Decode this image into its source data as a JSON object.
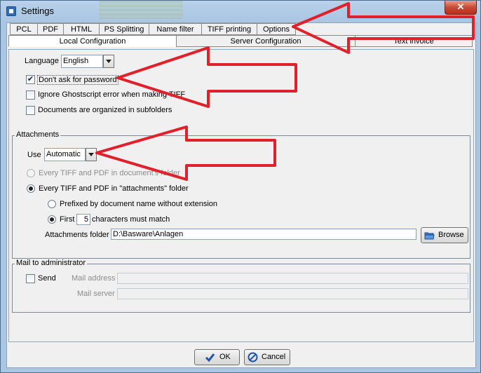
{
  "window": {
    "title": "Settings",
    "close_glyph": "✕"
  },
  "tabs_row1": [
    "PCL",
    "PDF",
    "HTML",
    "PS Splitting",
    "Name filter",
    "TIFF printing",
    "Options"
  ],
  "tabs_row2": [
    "Local Configuration",
    "Server Configuration",
    "Text invoice"
  ],
  "general": {
    "language_label": "Language",
    "language_value": "English",
    "dont_ask_password": "Don't ask for password",
    "dont_ask_password_checked": true,
    "ignore_ghostscript": "Ignore Ghostscript error when making TIFF",
    "ignore_ghostscript_checked": false,
    "subfolders": "Documents are organized in subfolders",
    "subfolders_checked": false
  },
  "attachments": {
    "legend": "Attachments",
    "use_label": "Use",
    "use_value": "Automatic",
    "opt_documents_folder": "Every TIFF and PDF in document's folder",
    "opt_attachments_folder": "Every TIFF and PDF in \"attachments\" folder",
    "opt_prefixed": "Prefixed by document name without extension",
    "opt_first": "First",
    "first_chars_value": "5",
    "chars_must_match": "characters must match",
    "folder_label": "Attachments folder",
    "folder_value": "D:\\Basware\\Anlagen",
    "browse_label": "Browse"
  },
  "mail": {
    "legend": "Mail to administrator",
    "send_label": "Send",
    "send_checked": false,
    "address_label": "Mail address",
    "address_value": "",
    "server_label": "Mail server",
    "server_value": ""
  },
  "footer": {
    "ok_label": "OK",
    "cancel_label": "Cancel"
  },
  "colors": {
    "annotation_arrow": "#e0202a",
    "window_frame": "#aac6e2",
    "close_button": "#c74a34"
  },
  "icons": [
    "app-icon",
    "close-icon",
    "dropdown-arrow-icon",
    "browse-folder-icon",
    "checkmark-icon",
    "cancel-icon"
  ]
}
